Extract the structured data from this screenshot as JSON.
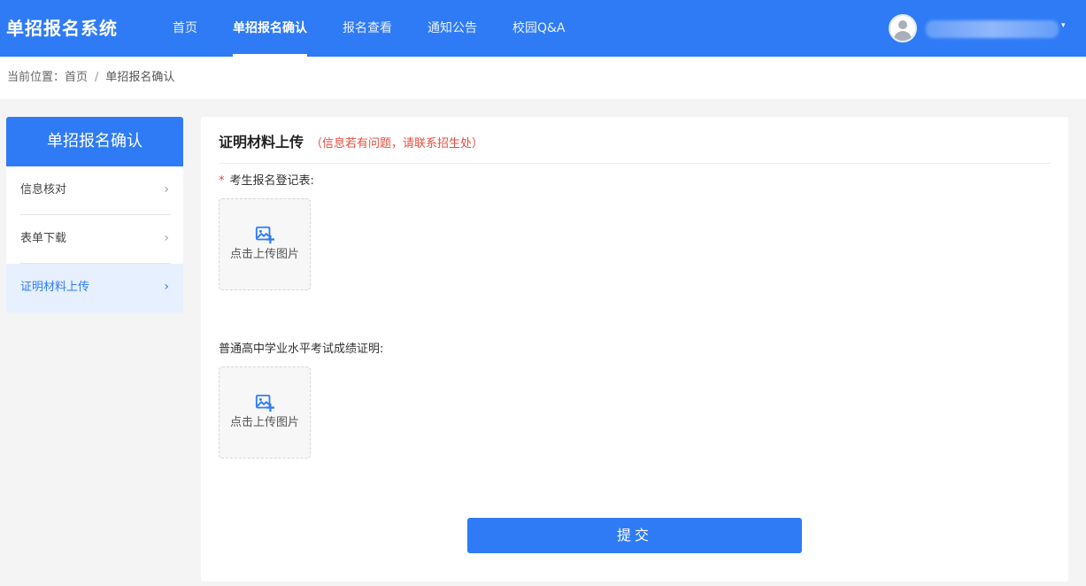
{
  "header": {
    "brand": "单招报名系统",
    "nav": [
      {
        "label": "首页"
      },
      {
        "label": "单招报名确认"
      },
      {
        "label": "报名查看"
      },
      {
        "label": "通知公告"
      },
      {
        "label": "校园Q&A"
      }
    ],
    "active_nav_index": 1,
    "user_caret": "▾"
  },
  "breadcrumb": {
    "prefix": "当前位置：",
    "home": "首页",
    "separator": "/",
    "current": "单招报名确认"
  },
  "sidebar": {
    "title": "单招报名确认",
    "items": [
      {
        "label": "信息核对",
        "chevron": "›"
      },
      {
        "label": "表单下载",
        "chevron": "›"
      },
      {
        "label": "证明材料上传",
        "chevron": "›"
      }
    ],
    "active_index": 2
  },
  "main": {
    "title": "证明材料上传",
    "note": "（信息若有问题，请联系招生处）",
    "fields": [
      {
        "required_mark": "*",
        "label": "考生报名登记表:",
        "upload_text": "点击上传图片",
        "icon": "image-add-icon"
      },
      {
        "required_mark": "",
        "label": "普通高中学业水平考试成绩证明:",
        "upload_text": "点击上传图片",
        "icon": "image-add-icon"
      }
    ],
    "submit_label": "提交"
  },
  "colors": {
    "primary": "#2f7bf6",
    "danger": "#e84c3d",
    "page_bg": "#f4f4f4"
  }
}
